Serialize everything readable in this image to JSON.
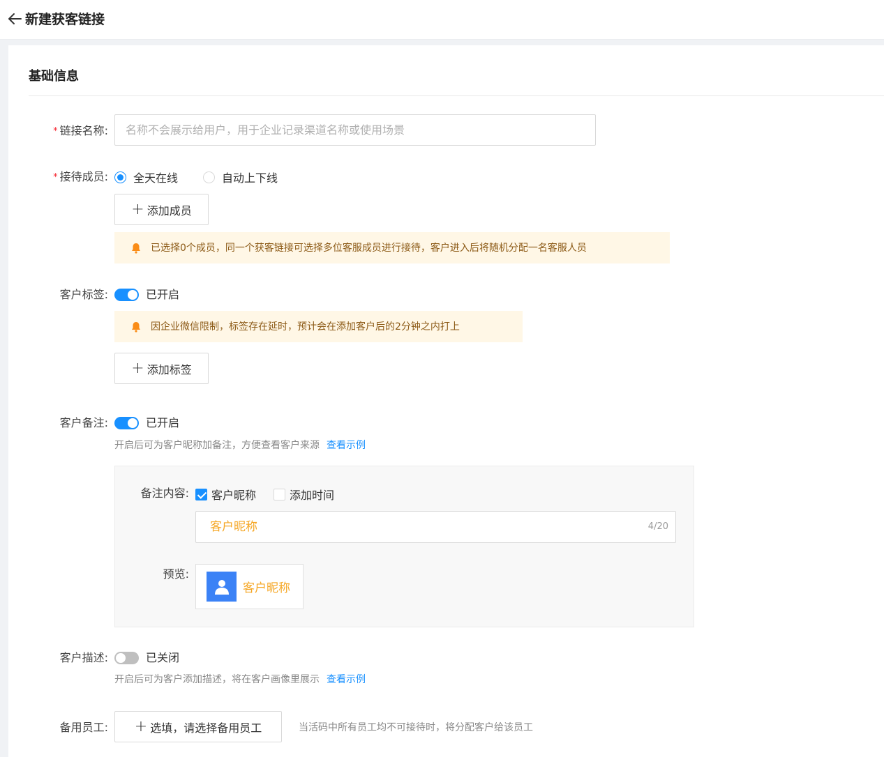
{
  "header": {
    "title": "新建获客链接",
    "back_icon": "arrow-left-icon"
  },
  "section": {
    "title": "基础信息"
  },
  "link_name": {
    "required_mark": "*",
    "label": "链接名称:",
    "placeholder": "名称不会展示给用户，用于企业记录渠道名称或使用场景"
  },
  "members": {
    "required_mark": "*",
    "label": "接待成员:",
    "options": [
      {
        "label": "全天在线",
        "selected": true
      },
      {
        "label": "自动上下线",
        "selected": false
      }
    ],
    "add_button": "添加成员",
    "notice": "已选择0个成员，同一个获客链接可选择多位客服成员进行接待，客户进入后将随机分配一名客服人员"
  },
  "tags": {
    "label": "客户标签:",
    "switch_on": true,
    "switch_text": "已开启",
    "notice": "因企业微信限制，标签存在延时，预计会在添加客户后的2分钟之内打上",
    "add_button": "添加标签"
  },
  "remark": {
    "label": "客户备注:",
    "switch_on": true,
    "switch_text": "已开启",
    "hint": "开启后可为客户昵称加备注，方便查看客户来源",
    "link": "查看示例",
    "content_label": "备注内容:",
    "checkboxes": [
      {
        "label": "客户昵称",
        "checked": true
      },
      {
        "label": "添加时间",
        "checked": false
      }
    ],
    "input_value": "客户昵称",
    "counter": "4/20",
    "preview_label": "预览:",
    "preview_name": "客户昵称"
  },
  "description": {
    "label": "客户描述:",
    "switch_on": false,
    "switch_text": "已关闭",
    "hint": "开启后可为客户添加描述，将在客户画像里展示",
    "link": "查看示例"
  },
  "backup": {
    "label": "备用员工:",
    "button": "选填，请选择备用员工",
    "hint": "当活码中所有员工均不可接待时，将分配客户给该员工"
  },
  "colors": {
    "primary": "#1890ff",
    "warning_bg": "#fff7e6",
    "warning_icon": "#fa8c16",
    "accent_orange": "#f5a623"
  }
}
